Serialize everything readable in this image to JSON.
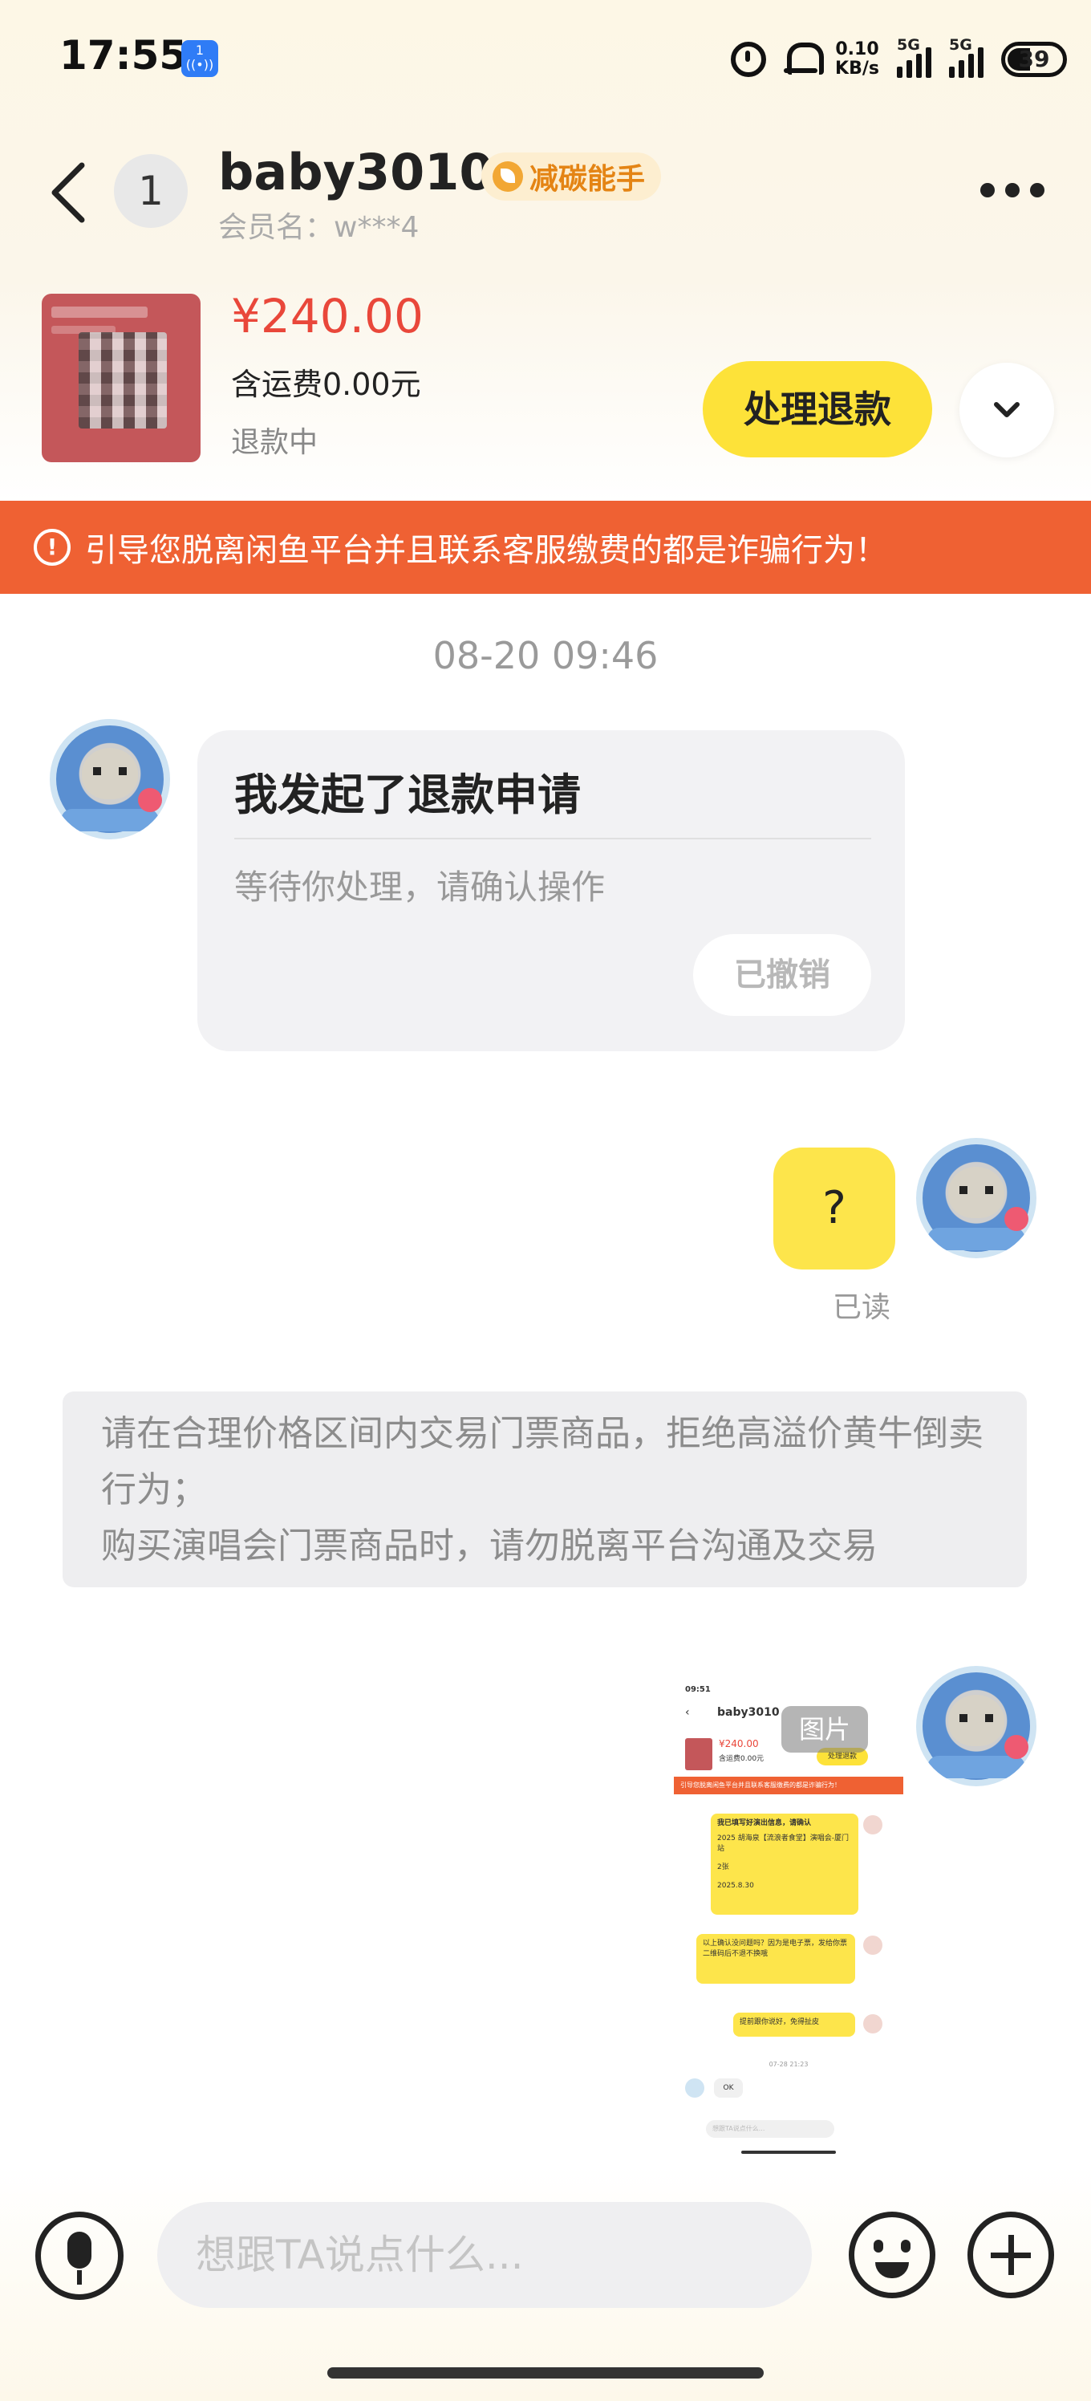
{
  "status_bar": {
    "time": "17:55",
    "net_speed_value": "0.10",
    "net_speed_unit": "KB/s",
    "signal1_label": "5G",
    "signal2_label": "5G",
    "battery": "39",
    "nfc_icon": "nfc-icon"
  },
  "header": {
    "unread_count": "1",
    "username": "baby3010",
    "tag": "减碳能手",
    "member_name": "会员名：w***4"
  },
  "product": {
    "price": "¥240.00",
    "shipping": "含运费0.00元",
    "status": "退款中",
    "action_label": "处理退款"
  },
  "warning": {
    "text": "引导您脱离闲鱼平台并且联系客服缴费的都是诈骗行为！"
  },
  "chat": {
    "timestamp": "08-20 09:46",
    "refund_card": {
      "title": "我发起了退款申请",
      "desc": "等待你处理，请确认操作",
      "button": "已撤销"
    },
    "my_message": "?",
    "read_status": "已读",
    "system_notice_line1": "请在合理价格区间内交易门票商品，拒绝高溢价黄牛倒卖行为；",
    "system_notice_line2": "购买演唱会门票商品时，请勿脱离平台沟通及交易",
    "image_tag": "图片",
    "image_preview": {
      "time": "09:51",
      "name": "baby3010",
      "price": "¥240.00",
      "shipping": "含运费0.00元",
      "action": "处理退款",
      "warning": "引导您脱离闲鱼平台并且联系客服缴费的都是诈骗行为！",
      "msg1_line1": "我已填写好演出信息，请确认",
      "msg1_line2": "2025 胡海泉【流浪者食堂】演唱会-厦门站",
      "msg1_line3": "2张",
      "msg1_line4": "2025.8.30",
      "msg2": "以上确认没问题吗？因为是电子票，发给你票二维码后不退不换哦",
      "msg3": "提前跟你说好，免得扯皮",
      "timestamp": "07-28 21:23",
      "reply": "OK",
      "input_placeholder": "想跟TA说点什么..."
    }
  },
  "input_bar": {
    "placeholder": "想跟TA说点什么..."
  },
  "colors": {
    "accent_yellow": "#fde239",
    "warning_orange": "#ef6133",
    "price_red": "#e9473a",
    "tag_orange": "#e48414"
  }
}
